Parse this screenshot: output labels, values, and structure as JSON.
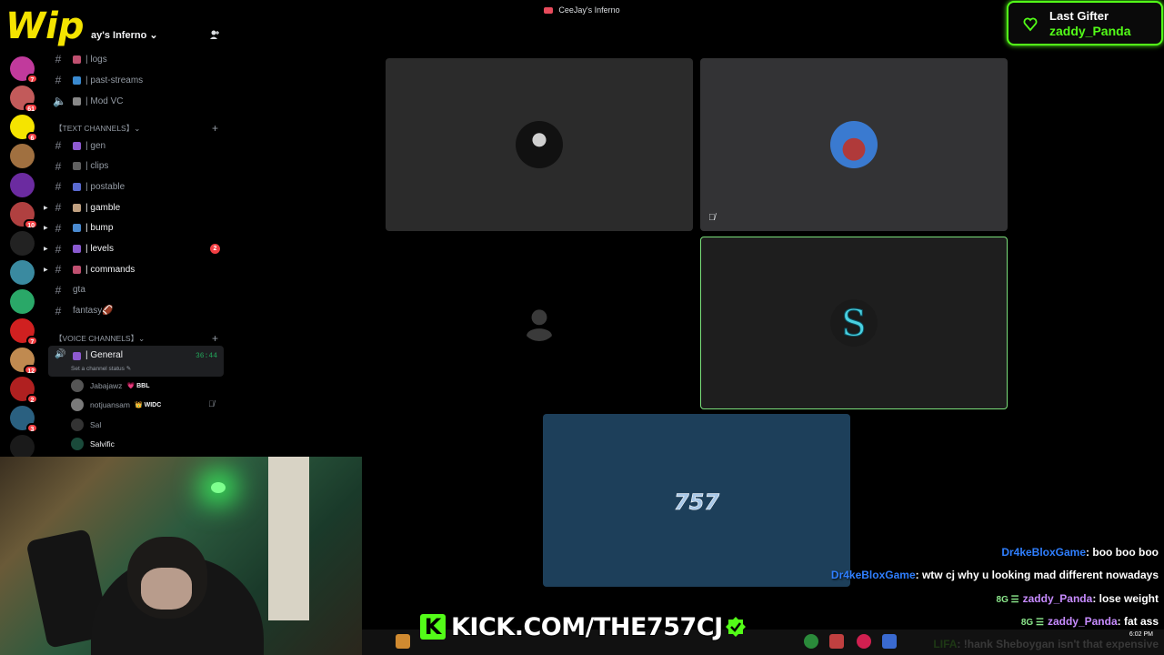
{
  "window": {
    "title": "CeeJay's Inferno"
  },
  "logo_text": "Wip",
  "server": {
    "name": "ay's Inferno"
  },
  "rail_servers": [
    {
      "color": "#c13a9c",
      "badge": "7"
    },
    {
      "color": "#c25a5a",
      "badge": "61"
    },
    {
      "color": "#f5e400",
      "badge": "6"
    },
    {
      "color": "#a07040",
      "badge": ""
    },
    {
      "color": "#6b2ba0",
      "badge": ""
    },
    {
      "color": "#b04040",
      "badge": "10"
    },
    {
      "color": "#222222",
      "badge": ""
    },
    {
      "color": "#3a8aa0",
      "badge": ""
    },
    {
      "color": "#2aa868",
      "badge": ""
    },
    {
      "color": "#d02020",
      "badge": "7"
    },
    {
      "color": "#c08a50",
      "badge": "12"
    },
    {
      "color": "#b02020",
      "badge": "2"
    },
    {
      "color": "#2a6080",
      "badge": "3"
    },
    {
      "color": "#1a1a1a",
      "badge": ""
    }
  ],
  "channels_top": [
    {
      "name": "| logs",
      "emoji_color": "#c05070"
    },
    {
      "name": "| past-streams",
      "emoji_color": "#3a8ad0"
    },
    {
      "name": "| Mod VC",
      "emoji_color": "#888888"
    }
  ],
  "text_category": "【TEXT CHANNELS】",
  "text_channels": [
    {
      "name": "| gen",
      "emoji_color": "#8e5ad0",
      "bold": false,
      "unread": ""
    },
    {
      "name": "| clips",
      "emoji_color": "#606060",
      "bold": false,
      "unread": ""
    },
    {
      "name": "| postable",
      "emoji_color": "#5a6ad0",
      "bold": false,
      "unread": ""
    },
    {
      "name": "| gamble",
      "emoji_color": "#c0a080",
      "bold": true,
      "unread": ""
    },
    {
      "name": "| bump",
      "emoji_color": "#4a8ad0",
      "bold": true,
      "unread": ""
    },
    {
      "name": "| levels",
      "emoji_color": "#8a5ad0",
      "bold": true,
      "unread": "2"
    },
    {
      "name": "| commands",
      "emoji_color": "#c05070",
      "bold": true,
      "unread": ""
    },
    {
      "name": "gta",
      "emoji_color": "",
      "bold": false,
      "unread": ""
    },
    {
      "name": "fantasy🏈",
      "emoji_color": "",
      "bold": false,
      "unread": ""
    }
  ],
  "voice_category": "【VOICE CHANNELS】",
  "voice_general": {
    "name": "| General",
    "time": "36:44",
    "status": "Set a channel status ✎"
  },
  "voice_members": [
    {
      "name": "Jabajawz",
      "tag": "💗 BBL",
      "avatar_color": "#555555",
      "bold": false
    },
    {
      "name": "notjuansam",
      "tag": "👑 WIDC",
      "avatar_color": "#7a7a7a",
      "bold": false
    },
    {
      "name": "Sal",
      "tag": "",
      "avatar_color": "#333333",
      "bold": false
    },
    {
      "name": "Salvific",
      "tag": "",
      "avatar_color": "#1a4a3a",
      "bold": true
    }
  ],
  "gifter": {
    "label": "Last Gifter",
    "name": "zaddy_Panda"
  },
  "chat": [
    {
      "user": "Dr4keBloxGame",
      "text": ": boo boo boo",
      "badge": "",
      "ucls": "u1"
    },
    {
      "user": "Dr4keBloxGame",
      "text": ": wtw cj why u looking mad different nowadays",
      "badge": "",
      "ucls": "u1"
    },
    {
      "user": "zaddy_Panda",
      "text": ": lose weight",
      "badge": "8G ☰",
      "ucls": "u2"
    },
    {
      "user": "zaddy_Panda",
      "text": ": fat ass",
      "badge": "8G ☰",
      "ucls": "u2"
    },
    {
      "user": "LIFA",
      "text": ": !hank Sheboygan isn't that expensive",
      "badge": "",
      "ucls": "u3"
    }
  ],
  "kick": {
    "k": "K",
    "url": "KICK.COM/THE757CJ"
  },
  "tile_logo_text": "757",
  "clock": "6:02 PM",
  "colors": {
    "kick_green": "#53fc18",
    "discord_bg": "#000000",
    "tile_blue": "#1d3f5a"
  }
}
